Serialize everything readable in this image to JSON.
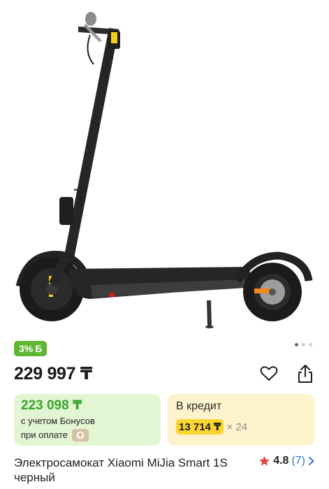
{
  "product": {
    "title": "Электросамокат Xiaomi MiJia Smart 1S черный",
    "image_alt": "Электросамокат Xiaomi MiJia Smart 1S черный"
  },
  "badge": {
    "discount": "3%",
    "currency_glyph": "Б",
    "color": "#5fb630"
  },
  "gallery": {
    "total_slides": 3,
    "active_index": 0
  },
  "price": {
    "current": "229 997 ₸"
  },
  "bonus": {
    "price": "223 098 ₸",
    "line1": "с учетом Бонусов",
    "line2": "при оплате",
    "accent_color": "#36a42a"
  },
  "credit": {
    "label": "В кредит",
    "monthly": "13 714 ₸",
    "months": "× 24"
  },
  "rating": {
    "value": "4.8",
    "count": "(7)"
  },
  "icons": {
    "favorite": "heart-icon",
    "share": "share-icon",
    "star": "star-icon",
    "next": "chevron-right-icon"
  }
}
